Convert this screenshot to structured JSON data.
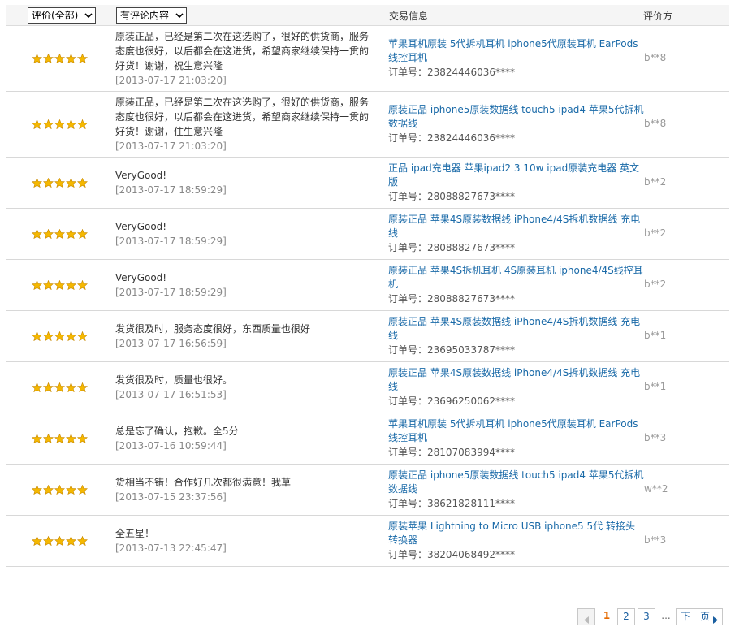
{
  "header": {
    "rating_filter": "评价(全部)",
    "content_filter": "有评论内容",
    "trade_info": "交易信息",
    "rater": "评价方"
  },
  "reviews": [
    {
      "stars": 5,
      "comment": "原装正品，已经是第二次在这选购了，很好的供货商，服务态度也很好，以后都会在这进货，希望商家继续保持一贯的好货！谢谢，祝生意兴隆",
      "time": "[2013-07-17 21:03:20]",
      "product": "苹果耳机原装 5代拆机耳机 iphone5代原装耳机 EarPods线控耳机",
      "order": "订单号：23824446036****",
      "rater": "b**8"
    },
    {
      "stars": 5,
      "comment": "原装正品，已经是第二次在这选购了，很好的供货商，服务态度也很好，以后都会在这进货，希望商家继续保持一贯的好货！谢谢，住生意兴隆",
      "time": "[2013-07-17 21:03:20]",
      "product": "原装正品 iphone5原装数据线 touch5 ipad4 苹果5代拆机数据线",
      "order": "订单号：23824446036****",
      "rater": "b**8"
    },
    {
      "stars": 5,
      "comment": "VeryGood!",
      "time": "[2013-07-17 18:59:29]",
      "product": "正品 ipad充电器 苹果ipad2 3 10w ipad原装充电器 英文版",
      "order": "订单号：28088827673****",
      "rater": "b**2"
    },
    {
      "stars": 5,
      "comment": "VeryGood!",
      "time": "[2013-07-17 18:59:29]",
      "product": "原装正品 苹果4S原装数据线 iPhone4/4S拆机数据线 充电线",
      "order": "订单号：28088827673****",
      "rater": "b**2"
    },
    {
      "stars": 5,
      "comment": "VeryGood!",
      "time": "[2013-07-17 18:59:29]",
      "product": "原装正品 苹果4S拆机耳机 4S原装耳机 iphone4/4S线控耳机",
      "order": "订单号：28088827673****",
      "rater": "b**2"
    },
    {
      "stars": 5,
      "comment": "发货很及时，服务态度很好，东西质量也很好",
      "time": "[2013-07-17 16:56:59]",
      "product": "原装正品 苹果4S原装数据线 iPhone4/4S拆机数据线 充电线",
      "order": "订单号：23695033787****",
      "rater": "b**1"
    },
    {
      "stars": 5,
      "comment": "发货很及时，质量也很好。",
      "time": "[2013-07-17 16:51:53]",
      "product": "原装正品 苹果4S原装数据线 iPhone4/4S拆机数据线 充电线",
      "order": "订单号：23696250062****",
      "rater": "b**1"
    },
    {
      "stars": 5,
      "comment": "总是忘了确认，抱歉。全5分",
      "time": "[2013-07-16 10:59:44]",
      "product": "苹果耳机原装 5代拆机耳机 iphone5代原装耳机 EarPods线控耳机",
      "order": "订单号：28107083994****",
      "rater": "b**3"
    },
    {
      "stars": 5,
      "comment": "货相当不错！合作好几次都很满意！我草",
      "time": "[2013-07-15 23:37:56]",
      "product": "原装正品 iphone5原装数据线 touch5 ipad4 苹果5代拆机数据线",
      "order": "订单号：38621828111****",
      "rater": "w**2"
    },
    {
      "stars": 5,
      "comment": "全五星！",
      "time": "[2013-07-13 22:45:47]",
      "product": "原装苹果 Lightning to Micro USB iphone5 5代 转接头 转换器",
      "order": "订单号：38204068492****",
      "rater": "b**3"
    }
  ],
  "pagination": {
    "current": "1",
    "page2": "2",
    "page3": "3",
    "ellipsis": "...",
    "next": "下一页"
  },
  "colors": {
    "link": "#1a6aa8",
    "star": "#f5b800",
    "current_page": "#e56a00"
  }
}
